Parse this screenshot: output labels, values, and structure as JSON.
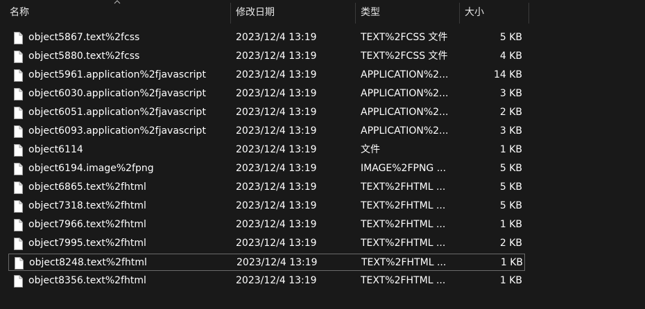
{
  "columns": {
    "name": "名称",
    "date": "修改日期",
    "type": "类型",
    "size": "大小"
  },
  "sort_indicator": "chevron-up-icon",
  "file_icon": "file-icon",
  "colors": {
    "background": "#191919",
    "text": "#ffffff",
    "header_text": "#e6e6e6",
    "divider": "#3b3b3b",
    "focus_outline": "#6b6b6b"
  },
  "files": [
    {
      "name": "object5867.text%2fcss",
      "date": "2023/12/4 13:19",
      "type": "TEXT%2FCSS 文件",
      "size": "5 KB"
    },
    {
      "name": "object5880.text%2fcss",
      "date": "2023/12/4 13:19",
      "type": "TEXT%2FCSS 文件",
      "size": "4 KB"
    },
    {
      "name": "object5961.application%2fjavascript",
      "date": "2023/12/4 13:19",
      "type": "APPLICATION%2...",
      "size": "14 KB"
    },
    {
      "name": "object6030.application%2fjavascript",
      "date": "2023/12/4 13:19",
      "type": "APPLICATION%2...",
      "size": "3 KB"
    },
    {
      "name": "object6051.application%2fjavascript",
      "date": "2023/12/4 13:19",
      "type": "APPLICATION%2...",
      "size": "2 KB"
    },
    {
      "name": "object6093.application%2fjavascript",
      "date": "2023/12/4 13:19",
      "type": "APPLICATION%2...",
      "size": "3 KB"
    },
    {
      "name": "object6114",
      "date": "2023/12/4 13:19",
      "type": "文件",
      "size": "1 KB"
    },
    {
      "name": "object6194.image%2fpng",
      "date": "2023/12/4 13:19",
      "type": "IMAGE%2FPNG ...",
      "size": "5 KB"
    },
    {
      "name": "object6865.text%2fhtml",
      "date": "2023/12/4 13:19",
      "type": "TEXT%2FHTML ...",
      "size": "5 KB"
    },
    {
      "name": "object7318.text%2fhtml",
      "date": "2023/12/4 13:19",
      "type": "TEXT%2FHTML ...",
      "size": "5 KB"
    },
    {
      "name": "object7966.text%2fhtml",
      "date": "2023/12/4 13:19",
      "type": "TEXT%2FHTML ...",
      "size": "1 KB"
    },
    {
      "name": "object7995.text%2fhtml",
      "date": "2023/12/4 13:19",
      "type": "TEXT%2FHTML ...",
      "size": "2 KB"
    },
    {
      "name": "object8248.text%2fhtml",
      "date": "2023/12/4 13:19",
      "type": "TEXT%2FHTML ...",
      "size": "1 KB",
      "focused": true
    },
    {
      "name": "object8356.text%2fhtml",
      "date": "2023/12/4 13:19",
      "type": "TEXT%2FHTML ...",
      "size": "1 KB"
    }
  ]
}
